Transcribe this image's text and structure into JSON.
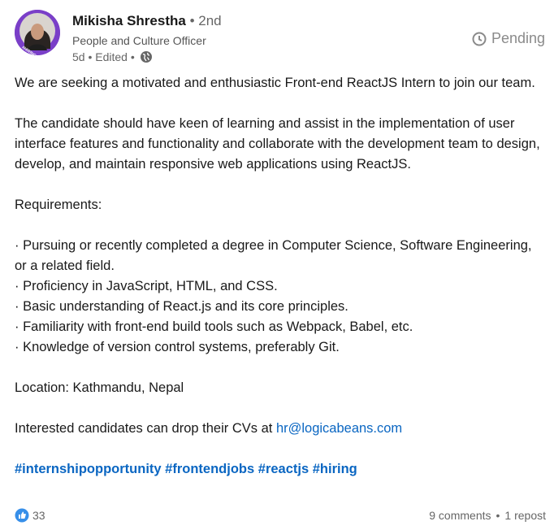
{
  "author": {
    "name": "Mikisha Shrestha",
    "degree": "• 2nd",
    "title": "People and Culture Officer",
    "time": "5d • Edited •",
    "avatar_badge": "#HIRING"
  },
  "status": {
    "label": "Pending"
  },
  "post": {
    "intro": "We are seeking a motivated and enthusiastic Front-end ReactJS Intern to join our team.",
    "description": "The candidate should have keen of learning and assist in the implementation of user interface features and functionality and collaborate with the development team to design, develop, and maintain responsive web applications using ReactJS.",
    "requirements_heading": "Requirements:",
    "requirements": [
      "·  Pursuing or recently completed a degree in Computer Science, Software Engineering, or a related field.",
      "·  Proficiency in JavaScript, HTML, and CSS.",
      "·  Basic understanding of React.js and its core principles.",
      "·  Familiarity with front-end build tools such as Webpack, Babel, etc.",
      "·  Knowledge of version control systems, preferably Git."
    ],
    "location": "Location: Kathmandu, Nepal",
    "cv_prefix": "Interested candidates can drop their CVs at ",
    "cv_email": "hr@logicabeans.com",
    "hashtags": [
      "#internshipopportunity",
      "#frontendjobs",
      "#reactjs",
      "#hiring"
    ]
  },
  "footer": {
    "reaction_count": "33",
    "comments": "9 comments",
    "separator": "•",
    "reposts": "1 repost"
  },
  "colors": {
    "link": "#0a66c2",
    "text": "#191919",
    "muted": "#666666",
    "badge": "#7a3fc8"
  }
}
